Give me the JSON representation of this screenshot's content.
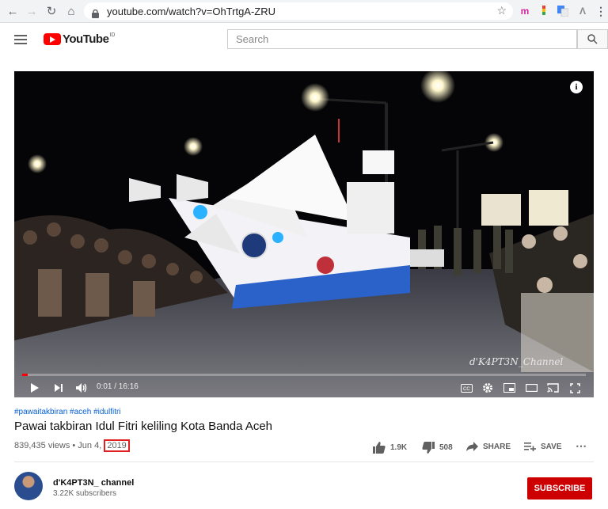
{
  "browser": {
    "url": "youtube.com/watch?v=OhTrtgA-ZRU"
  },
  "header": {
    "logo_text": "YouTube",
    "logo_region": "ID",
    "search_placeholder": "Search"
  },
  "player": {
    "time": "0:01 / 16:16",
    "watermark": "d'K4PT3N_Channel",
    "info_glyph": "i",
    "progress_fraction": 0.001
  },
  "video": {
    "hashtags": "#pawaitakbiran #aceh #idulfitri",
    "title": "Pawai takbiran Idul Fitri keliling Kota Banda Aceh",
    "views_date": "839,435 views • Jun 4,",
    "year": "2019"
  },
  "actions": {
    "likes": "1.9K",
    "dislikes": "508",
    "share": "SHARE",
    "save": "SAVE"
  },
  "channel": {
    "name": "d'K4PT3N_ channel",
    "subscribers": "3.22K subscribers",
    "subscribe_label": "SUBSCRIBE"
  },
  "colors": {
    "brand_red": "#ff0000",
    "subscribe_red": "#cc0000",
    "link_blue": "#065fd4"
  }
}
